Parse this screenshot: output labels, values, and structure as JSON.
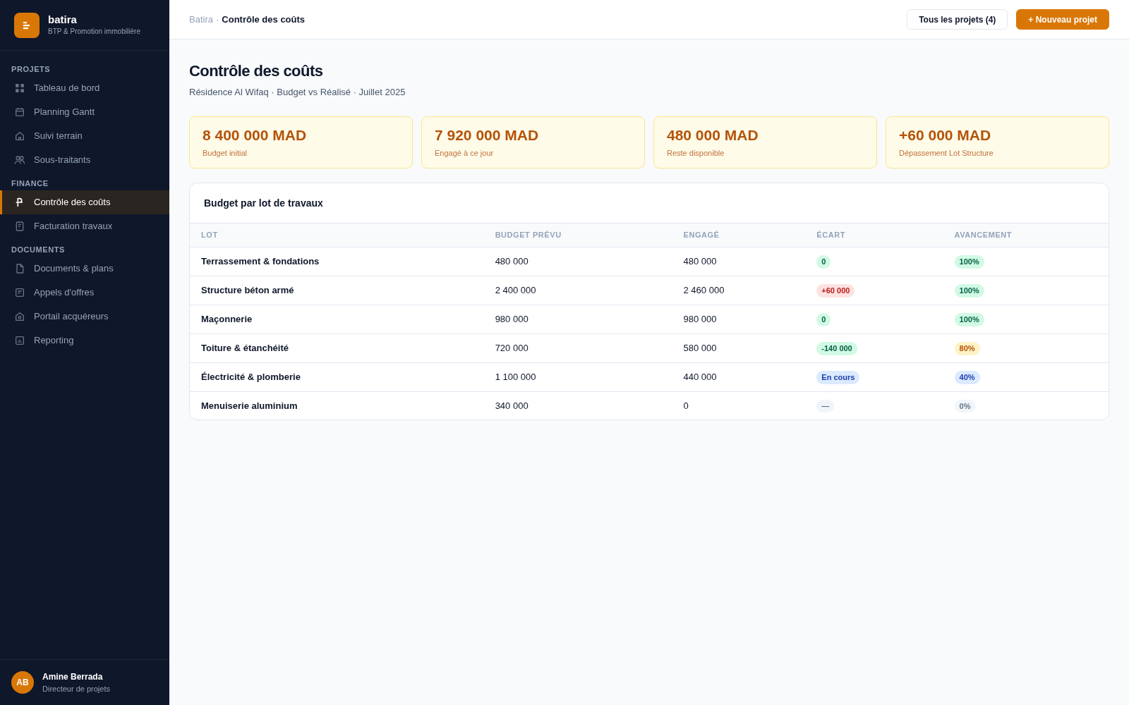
{
  "brand": {
    "name": "batira",
    "tagline": "BTP & Promotion immobilière"
  },
  "sidebar": {
    "sections": [
      {
        "title": "PROJETS",
        "items": [
          {
            "label": "Tableau de bord",
            "selected": false
          },
          {
            "label": "Planning Gantt",
            "selected": false
          },
          {
            "label": "Suivi terrain",
            "selected": false
          },
          {
            "label": "Sous-traitants",
            "selected": false
          }
        ]
      },
      {
        "title": "FINANCE",
        "items": [
          {
            "label": "Contrôle des coûts",
            "selected": true
          },
          {
            "label": "Facturation travaux",
            "selected": false
          }
        ]
      },
      {
        "title": "DOCUMENTS",
        "items": [
          {
            "label": "Documents & plans",
            "selected": false
          },
          {
            "label": "Appels d'offres",
            "selected": false
          },
          {
            "label": "Portail acquéreurs",
            "selected": false
          },
          {
            "label": "Reporting",
            "selected": false
          }
        ]
      }
    ]
  },
  "user": {
    "initials": "AB",
    "name": "Amine Berrada",
    "role": "Directeur de projets"
  },
  "breadcrumb": {
    "root": "Batira",
    "separator": "·",
    "current": "Contrôle des coûts"
  },
  "header_buttons": [
    {
      "label": "Tous les projets (4)",
      "kind": "secondary"
    },
    {
      "label": "+ Nouveau projet",
      "kind": "primary"
    }
  ],
  "page": {
    "title": "Contrôle des coûts",
    "subtitle": "Résidence Al Wifaq · Budget vs Réalisé · Juillet 2025"
  },
  "stats": [
    {
      "value": "8 400 000 MAD",
      "label": "Budget initial"
    },
    {
      "value": "7 920 000 MAD",
      "label": "Engagé à ce jour"
    },
    {
      "value": "480 000 MAD",
      "label": "Reste disponible"
    },
    {
      "value": "+60 000 MAD",
      "label": "Dépassement Lot Structure"
    }
  ],
  "table": {
    "title": "Budget par lot de travaux",
    "columns": [
      "LOT",
      "BUDGET PRÉVU",
      "ENGAGÉ",
      "ÉCART",
      "AVANCEMENT"
    ],
    "rows": [
      {
        "lot": "Terrassement & fondations",
        "budget": "480 000",
        "engage": "480 000",
        "ecart": {
          "text": "0",
          "kind": "success"
        },
        "avancement": {
          "text": "100%",
          "kind": "success"
        }
      },
      {
        "lot": "Structure béton armé",
        "budget": "2 400 000",
        "engage": "2 460 000",
        "ecart": {
          "text": "+60 000",
          "kind": "danger"
        },
        "avancement": {
          "text": "100%",
          "kind": "success"
        }
      },
      {
        "lot": "Maçonnerie",
        "budget": "980 000",
        "engage": "980 000",
        "ecart": {
          "text": "0",
          "kind": "success"
        },
        "avancement": {
          "text": "100%",
          "kind": "success"
        }
      },
      {
        "lot": "Toiture & étanchéité",
        "budget": "720 000",
        "engage": "580 000",
        "ecart": {
          "text": "-140 000",
          "kind": "success"
        },
        "avancement": {
          "text": "80%",
          "kind": "warning"
        }
      },
      {
        "lot": "Électricité & plomberie",
        "budget": "1 100 000",
        "engage": "440 000",
        "ecart": {
          "text": "En cours",
          "kind": "info"
        },
        "avancement": {
          "text": "40%",
          "kind": "info"
        }
      },
      {
        "lot": "Menuiserie aluminium",
        "budget": "340 000",
        "engage": "0",
        "ecart": {
          "text": "—",
          "kind": "neutral"
        },
        "avancement": {
          "text": "0%",
          "kind": "neutral"
        }
      }
    ]
  }
}
